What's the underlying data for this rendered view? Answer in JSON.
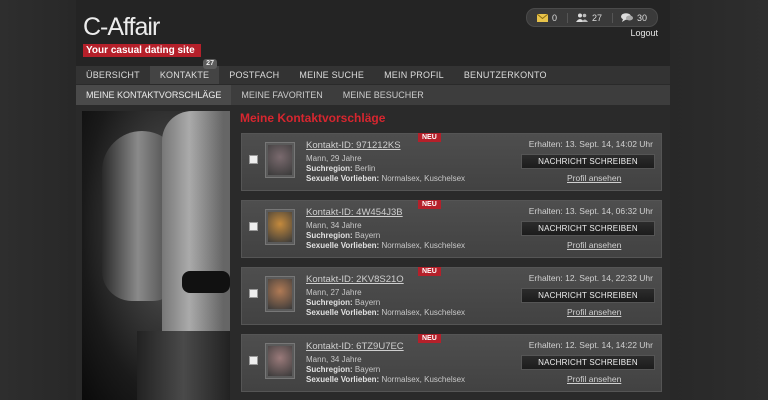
{
  "brand": {
    "logo": "C-Affair",
    "tagline": "Your casual dating site"
  },
  "header": {
    "counters": [
      {
        "icon": "envelope-icon",
        "value": "0"
      },
      {
        "icon": "users-icon",
        "value": "27"
      },
      {
        "icon": "chat-bubble-icon",
        "value": "30"
      }
    ],
    "logout": "Logout"
  },
  "mainnav": [
    {
      "label": "ÜBERSICHT"
    },
    {
      "label": "KONTAKTE",
      "badge": "27"
    },
    {
      "label": "POSTFACH"
    },
    {
      "label": "MEINE SUCHE"
    },
    {
      "label": "MEIN PROFIL"
    },
    {
      "label": "BENUTZERKONTO"
    }
  ],
  "subnav": [
    {
      "label": "MEINE KONTAKTVORSCHLÄGE"
    },
    {
      "label": "MEINE FAVORITEN"
    },
    {
      "label": "MEINE BESUCHER"
    }
  ],
  "section_title": "Meine Kontaktvorschläge",
  "labels": {
    "region": "Suchregion:",
    "preferences": "Sexuelle Vorlieben:",
    "new_badge": "NEU",
    "message_button": "NACHRICHT SCHREIBEN",
    "profile_link": "Profil ansehen"
  },
  "contacts": [
    {
      "id": "Kontakt-ID: 971212KS",
      "age": "Mann, 29 Jahre",
      "region": "Berlin",
      "preferences": "Normalsex, Kuschelsex",
      "received": "Erhalten: 13. Sept. 14, 14:02 Uhr",
      "thumb_color": "#7a6a6e"
    },
    {
      "id": "Kontakt-ID: 4W454J3B",
      "age": "Mann, 34 Jahre",
      "region": "Bayern",
      "preferences": "Normalsex, Kuschelsex",
      "received": "Erhalten: 13. Sept. 14, 06:32 Uhr",
      "thumb_color": "#c48a3c"
    },
    {
      "id": "Kontakt-ID: 2KV8S21O",
      "age": "Mann, 27 Jahre",
      "region": "Bayern",
      "preferences": "Normalsex, Kuschelsex",
      "received": "Erhalten: 12. Sept. 14, 22:32 Uhr",
      "thumb_color": "#b07a55"
    },
    {
      "id": "Kontakt-ID: 6TZ9U7EC",
      "age": "Mann, 34 Jahre",
      "region": "Bayern",
      "preferences": "Normalsex, Kuschelsex",
      "received": "Erhalten: 12. Sept. 14, 14:22 Uhr",
      "thumb_color": "#9a7a7a"
    }
  ]
}
